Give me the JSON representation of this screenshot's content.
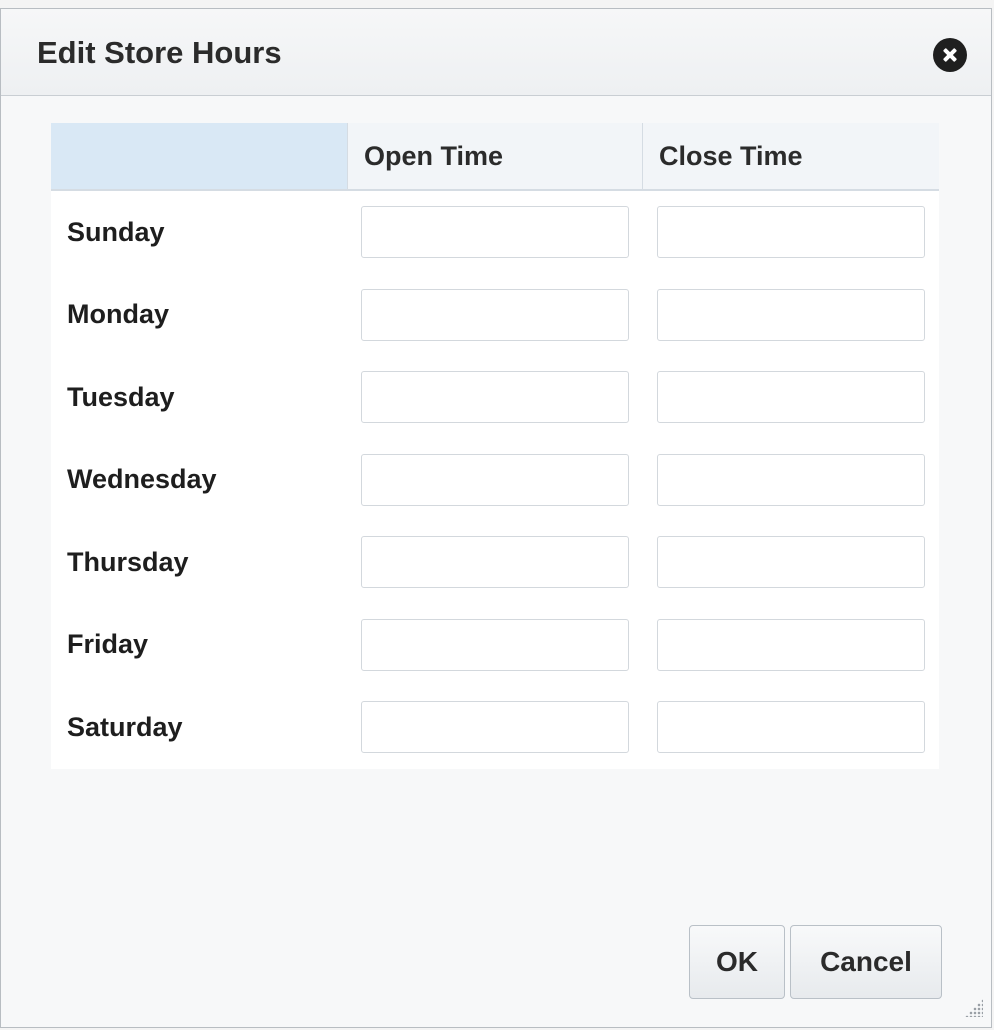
{
  "dialog": {
    "title": "Edit Store Hours",
    "close_icon": "close-circle-icon"
  },
  "table": {
    "columns": [
      "",
      "Open Time",
      "Close Time"
    ],
    "rows": [
      {
        "day": "Sunday",
        "open": "",
        "close": ""
      },
      {
        "day": "Monday",
        "open": "",
        "close": ""
      },
      {
        "day": "Tuesday",
        "open": "",
        "close": ""
      },
      {
        "day": "Wednesday",
        "open": "",
        "close": ""
      },
      {
        "day": "Thursday",
        "open": "",
        "close": ""
      },
      {
        "day": "Friday",
        "open": "",
        "close": ""
      },
      {
        "day": "Saturday",
        "open": "",
        "close": ""
      }
    ]
  },
  "footer": {
    "ok_label": "OK",
    "cancel_label": "Cancel"
  },
  "colors": {
    "header_blank_cell": "#d9e8f5",
    "dialog_background": "#f7f8f9"
  }
}
